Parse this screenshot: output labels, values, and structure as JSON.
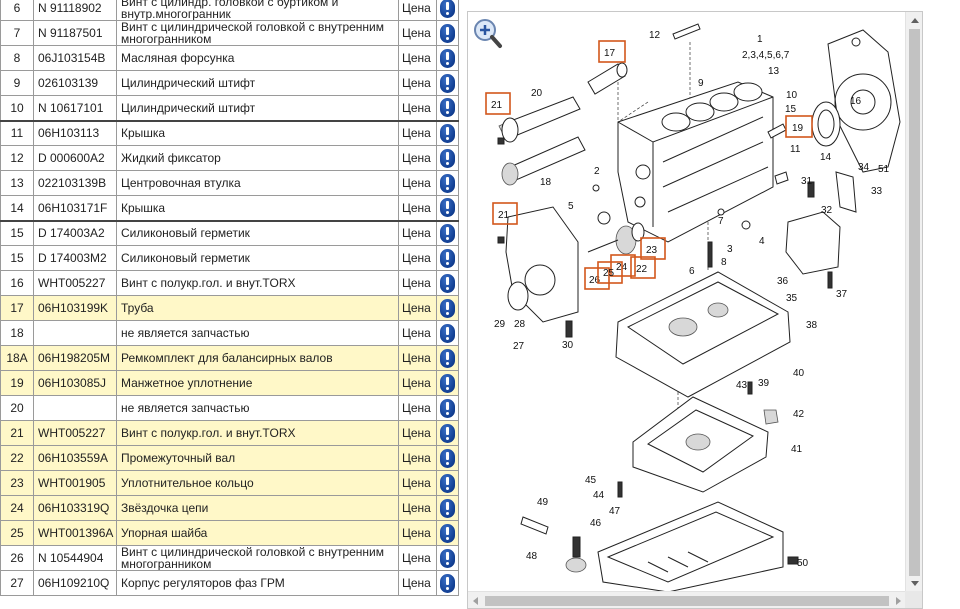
{
  "table": {
    "price_label": "Цена",
    "rows": [
      {
        "num": "6",
        "part": "N 91118902",
        "name": "Винт с цилиндр. головкой с буртиком и внутр.многогранник",
        "price": "Цена",
        "hl": false
      },
      {
        "num": "7",
        "part": "N 91187501",
        "name": "Винт с цилиндрической головкой с внутренним многогранником",
        "price": "Цена",
        "hl": false
      },
      {
        "num": "8",
        "part": "06J103154B",
        "name": "Масляная форсунка",
        "price": "Цена",
        "hl": false
      },
      {
        "num": "9",
        "part": "026103139",
        "name": "Цилиндрический штифт",
        "price": "Цена",
        "hl": false
      },
      {
        "num": "10",
        "part": "N 10617101",
        "name": "Цилиндрический штифт",
        "price": "Цена",
        "hl": false
      },
      {
        "num": "11",
        "part": "06H103113",
        "name": "Крышка",
        "price": "Цена",
        "hl": false
      },
      {
        "num": "12",
        "part": "D 000600A2",
        "name": "Жидкий фиксатор",
        "price": "Цена",
        "hl": false
      },
      {
        "num": "13",
        "part": "022103139B",
        "name": "Центровочная втулка",
        "price": "Цена",
        "hl": false
      },
      {
        "num": "14",
        "part": "06H103171F",
        "name": "Крышка",
        "price": "Цена",
        "hl": false
      },
      {
        "num": "15",
        "part": "D 174003A2",
        "name": "Силиконовый герметик",
        "price": "Цена",
        "hl": false
      },
      {
        "num": "15",
        "part": "D 174003M2",
        "name": "Силиконовый герметик",
        "price": "Цена",
        "hl": false
      },
      {
        "num": "16",
        "part": "WHT005227",
        "name": "Винт с полукр.гол. и внут.TORX",
        "price": "Цена",
        "hl": false
      },
      {
        "num": "17",
        "part": "06H103199K",
        "name": "Труба",
        "price": "Цена",
        "hl": true
      },
      {
        "num": "18",
        "part": "",
        "name": "не является запчастью",
        "price": "Цена",
        "hl": false
      },
      {
        "num": "18A",
        "part": "06H198205M",
        "name": "Ремкомплект для балансирных валов",
        "price": "Цена",
        "hl": true
      },
      {
        "num": "19",
        "part": "06H103085J",
        "name": "Манжетное уплотнение",
        "price": "Цена",
        "hl": true
      },
      {
        "num": "20",
        "part": "",
        "name": "не является запчастью",
        "price": "Цена",
        "hl": false
      },
      {
        "num": "21",
        "part": "WHT005227",
        "name": "Винт с полукр.гол. и внут.TORX",
        "price": "Цена",
        "hl": true
      },
      {
        "num": "22",
        "part": "06H103559A",
        "name": "Промежуточный вал",
        "price": "Цена",
        "hl": true
      },
      {
        "num": "23",
        "part": "WHT001905",
        "name": "Уплотнительное кольцо",
        "price": "Цена",
        "hl": true
      },
      {
        "num": "24",
        "part": "06H103319Q",
        "name": "Звёздочка цепи",
        "price": "Цена",
        "hl": true
      },
      {
        "num": "25",
        "part": "WHT001396A",
        "name": "Упорная шайба",
        "price": "Цена",
        "hl": true
      },
      {
        "num": "26",
        "part": "N 10544904",
        "name": "Винт с цилиндрической головкой с внутренним многогранником",
        "price": "Цена",
        "hl": false
      },
      {
        "num": "27",
        "part": "06H109210Q",
        "name": "Корпус регуляторов фаз ГРМ",
        "price": "Цена",
        "hl": false
      }
    ]
  },
  "diagram": {
    "highlighted_callouts": [
      "17",
      "21",
      "19",
      "21",
      "23",
      "24",
      "22",
      "26",
      "25"
    ],
    "callouts": [
      "1",
      "2,3,4,5,6,7",
      "12",
      "9",
      "13",
      "10",
      "16",
      "15",
      "14",
      "51",
      "34",
      "33",
      "31",
      "32",
      "11",
      "20",
      "18",
      "2",
      "5",
      "3",
      "7",
      "8",
      "4",
      "6",
      "36",
      "35",
      "37",
      "29",
      "28",
      "27",
      "30",
      "38",
      "40",
      "39",
      "42",
      "41",
      "43",
      "45",
      "44",
      "49",
      "47",
      "46",
      "48",
      "50"
    ]
  },
  "colors": {
    "highlight_row": "#fff8c8",
    "callout_box": "#d2571c",
    "info_icon": "#123f93"
  },
  "icons": {
    "info": "info-icon",
    "zoom": "zoom-in-icon"
  }
}
